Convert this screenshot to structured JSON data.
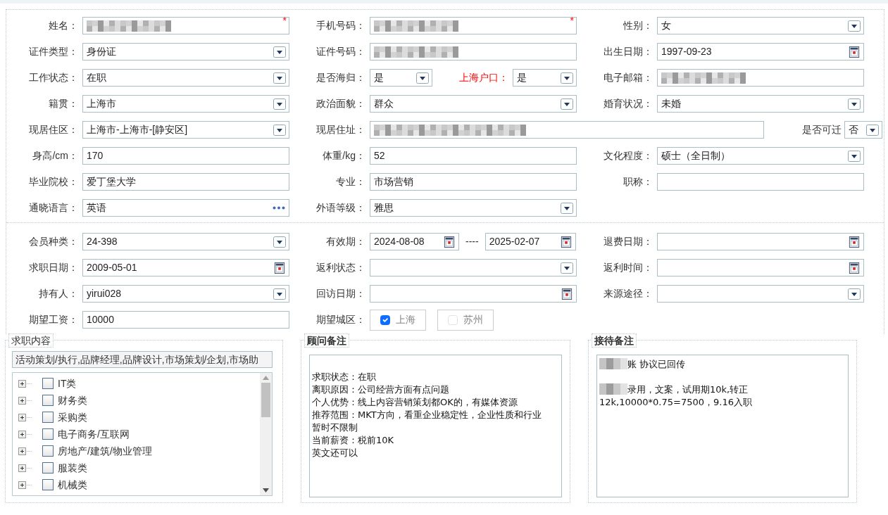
{
  "sections": [
    {
      "rows": [
        [
          {
            "kind": "field",
            "label": "姓名：",
            "field": {
              "kind": "text",
              "blurred": true,
              "required_mark": "*"
            }
          },
          {
            "kind": "field",
            "label": "手机号码：",
            "field": {
              "kind": "text",
              "blurred": true,
              "required_mark": "*"
            }
          },
          {
            "kind": "field",
            "label": "性别：",
            "field": {
              "kind": "select",
              "value": "女"
            }
          }
        ],
        [
          {
            "kind": "field",
            "label": "证件类型：",
            "field": {
              "kind": "select",
              "value": "身份证"
            }
          },
          {
            "kind": "field",
            "label": "证件号码：",
            "field": {
              "kind": "text",
              "blurred": true
            }
          },
          {
            "kind": "field",
            "label": "出生日期：",
            "field": {
              "kind": "date",
              "value": "1997-09-23"
            }
          }
        ],
        [
          {
            "kind": "field",
            "label": "工作状态：",
            "field": {
              "kind": "select",
              "value": "在职"
            }
          },
          {
            "kind": "dual",
            "label": "是否海归：",
            "field": {
              "kind": "select",
              "value": "是"
            },
            "label2": "上海户口：",
            "emphasis2": true,
            "field2": {
              "kind": "select",
              "value": "是"
            }
          },
          {
            "kind": "field",
            "label": "电子邮箱：",
            "field": {
              "kind": "text",
              "blurred": true
            }
          }
        ],
        [
          {
            "kind": "field",
            "label": "籍贯：",
            "field": {
              "kind": "select",
              "value": "上海市"
            }
          },
          {
            "kind": "field",
            "label": "政治面貌：",
            "field": {
              "kind": "select",
              "value": "群众"
            }
          },
          {
            "kind": "field",
            "label": "婚育状况：",
            "field": {
              "kind": "select",
              "value": "未婚"
            }
          }
        ],
        [
          {
            "kind": "field",
            "label": "现居住区：",
            "field": {
              "kind": "select",
              "value": "上海市-上海市-[静安区]"
            }
          },
          {
            "kind": "wide",
            "label": "现居住址：",
            "field": {
              "kind": "text",
              "blurred": true
            },
            "label2": "是否可迁",
            "field2": {
              "kind": "select",
              "value": "否"
            }
          }
        ],
        [
          {
            "kind": "field",
            "label": "身高/cm：",
            "field": {
              "kind": "text",
              "value": "170"
            }
          },
          {
            "kind": "field",
            "label": "体重/kg：",
            "field": {
              "kind": "text",
              "value": "52"
            }
          },
          {
            "kind": "field",
            "label": "文化程度：",
            "field": {
              "kind": "select",
              "value": "硕士（全日制）"
            }
          }
        ],
        [
          {
            "kind": "field",
            "label": "毕业院校：",
            "field": {
              "kind": "text",
              "value": "爱丁堡大学"
            }
          },
          {
            "kind": "field",
            "label": "专业：",
            "field": {
              "kind": "text",
              "value": "市场营销"
            }
          },
          {
            "kind": "field",
            "label": "职称：",
            "field": {
              "kind": "text"
            }
          }
        ],
        [
          {
            "kind": "field",
            "label": "通晓语言：",
            "field": {
              "kind": "picker",
              "value": "英语"
            }
          },
          {
            "kind": "field",
            "label": "外语等级：",
            "field": {
              "kind": "select",
              "value": "雅思"
            }
          },
          {
            "kind": "empty"
          }
        ]
      ]
    },
    {
      "rows": [
        [
          {
            "kind": "field",
            "label": "会员种类：",
            "field": {
              "kind": "select",
              "value": "24-398"
            }
          },
          {
            "kind": "range",
            "label": "有效期：",
            "field": {
              "kind": "date",
              "value": "2024-08-08"
            },
            "separator": "----",
            "field2": {
              "kind": "date",
              "value": "2025-02-07"
            }
          },
          {
            "kind": "field",
            "label": "退费日期：",
            "field": {
              "kind": "date"
            }
          }
        ],
        [
          {
            "kind": "field",
            "label": "求职日期：",
            "field": {
              "kind": "date",
              "value": "2009-05-01"
            }
          },
          {
            "kind": "field",
            "label": "返利状态：",
            "field": {
              "kind": "select"
            }
          },
          {
            "kind": "field",
            "label": "返利时间：",
            "field": {
              "kind": "date"
            }
          }
        ],
        [
          {
            "kind": "field",
            "label": "持有人：",
            "field": {
              "kind": "select",
              "value": "yirui028"
            }
          },
          {
            "kind": "field",
            "label": "回访日期：",
            "field": {
              "kind": "date"
            }
          },
          {
            "kind": "field",
            "label": "来源途径：",
            "field": {
              "kind": "select"
            }
          }
        ],
        [
          {
            "kind": "field",
            "label": "期望工资：",
            "field": {
              "kind": "text",
              "value": "10000"
            }
          },
          {
            "kind": "checks",
            "label": "期望城区：",
            "options": [
              {
                "label": "上海",
                "checked": true
              },
              {
                "label": "苏州",
                "checked": false
              }
            ]
          },
          {
            "kind": "empty"
          }
        ]
      ]
    }
  ],
  "job_panel": {
    "legend": "求职内容",
    "bold": false,
    "summary": "活动策划/执行,品牌经理,品牌设计,市场策划/企划,市场助",
    "tree": [
      {
        "label": "IT类",
        "checked": false,
        "expanded": false
      },
      {
        "label": "财务类",
        "checked": false,
        "expanded": false
      },
      {
        "label": "采购类",
        "checked": false,
        "expanded": false
      },
      {
        "label": "电子商务/互联网",
        "checked": false,
        "expanded": false
      },
      {
        "label": "房地产/建筑/物业管理",
        "checked": false,
        "expanded": false
      },
      {
        "label": "服装类",
        "checked": false,
        "expanded": false
      },
      {
        "label": "机械类",
        "checked": false,
        "expanded": false
      }
    ]
  },
  "note_panels": [
    {
      "legend": "顾问备注",
      "bold": true,
      "lines": [
        {
          "kind": "blank"
        },
        {
          "kind": "text",
          "text": "求职状态：在职"
        },
        {
          "kind": "text",
          "text": "离职原因：公司经营方面有点问题"
        },
        {
          "kind": "text",
          "text": "个人优势：线上内容营销策划都OK的，有媒体资源"
        },
        {
          "kind": "text",
          "text": "推荐范围：MKT方向，看重企业稳定性，企业性质和行业"
        },
        {
          "kind": "text",
          "text": "暂时不限制"
        },
        {
          "kind": "text",
          "text": "当前薪资：税前10K"
        },
        {
          "kind": "text",
          "text": "英文还可以"
        }
      ]
    },
    {
      "legend": "接待备注",
      "bold": true,
      "lines": [
        {
          "kind": "text",
          "text": "账 协议已回传",
          "blurred_prefix": true
        },
        {
          "kind": "blank"
        },
        {
          "kind": "text",
          "text": "录用，文案，试用期10k,转正",
          "blurred_prefix": true
        },
        {
          "kind": "text",
          "text": "12k,10000*0.75=7500，9.16入职"
        }
      ]
    }
  ]
}
